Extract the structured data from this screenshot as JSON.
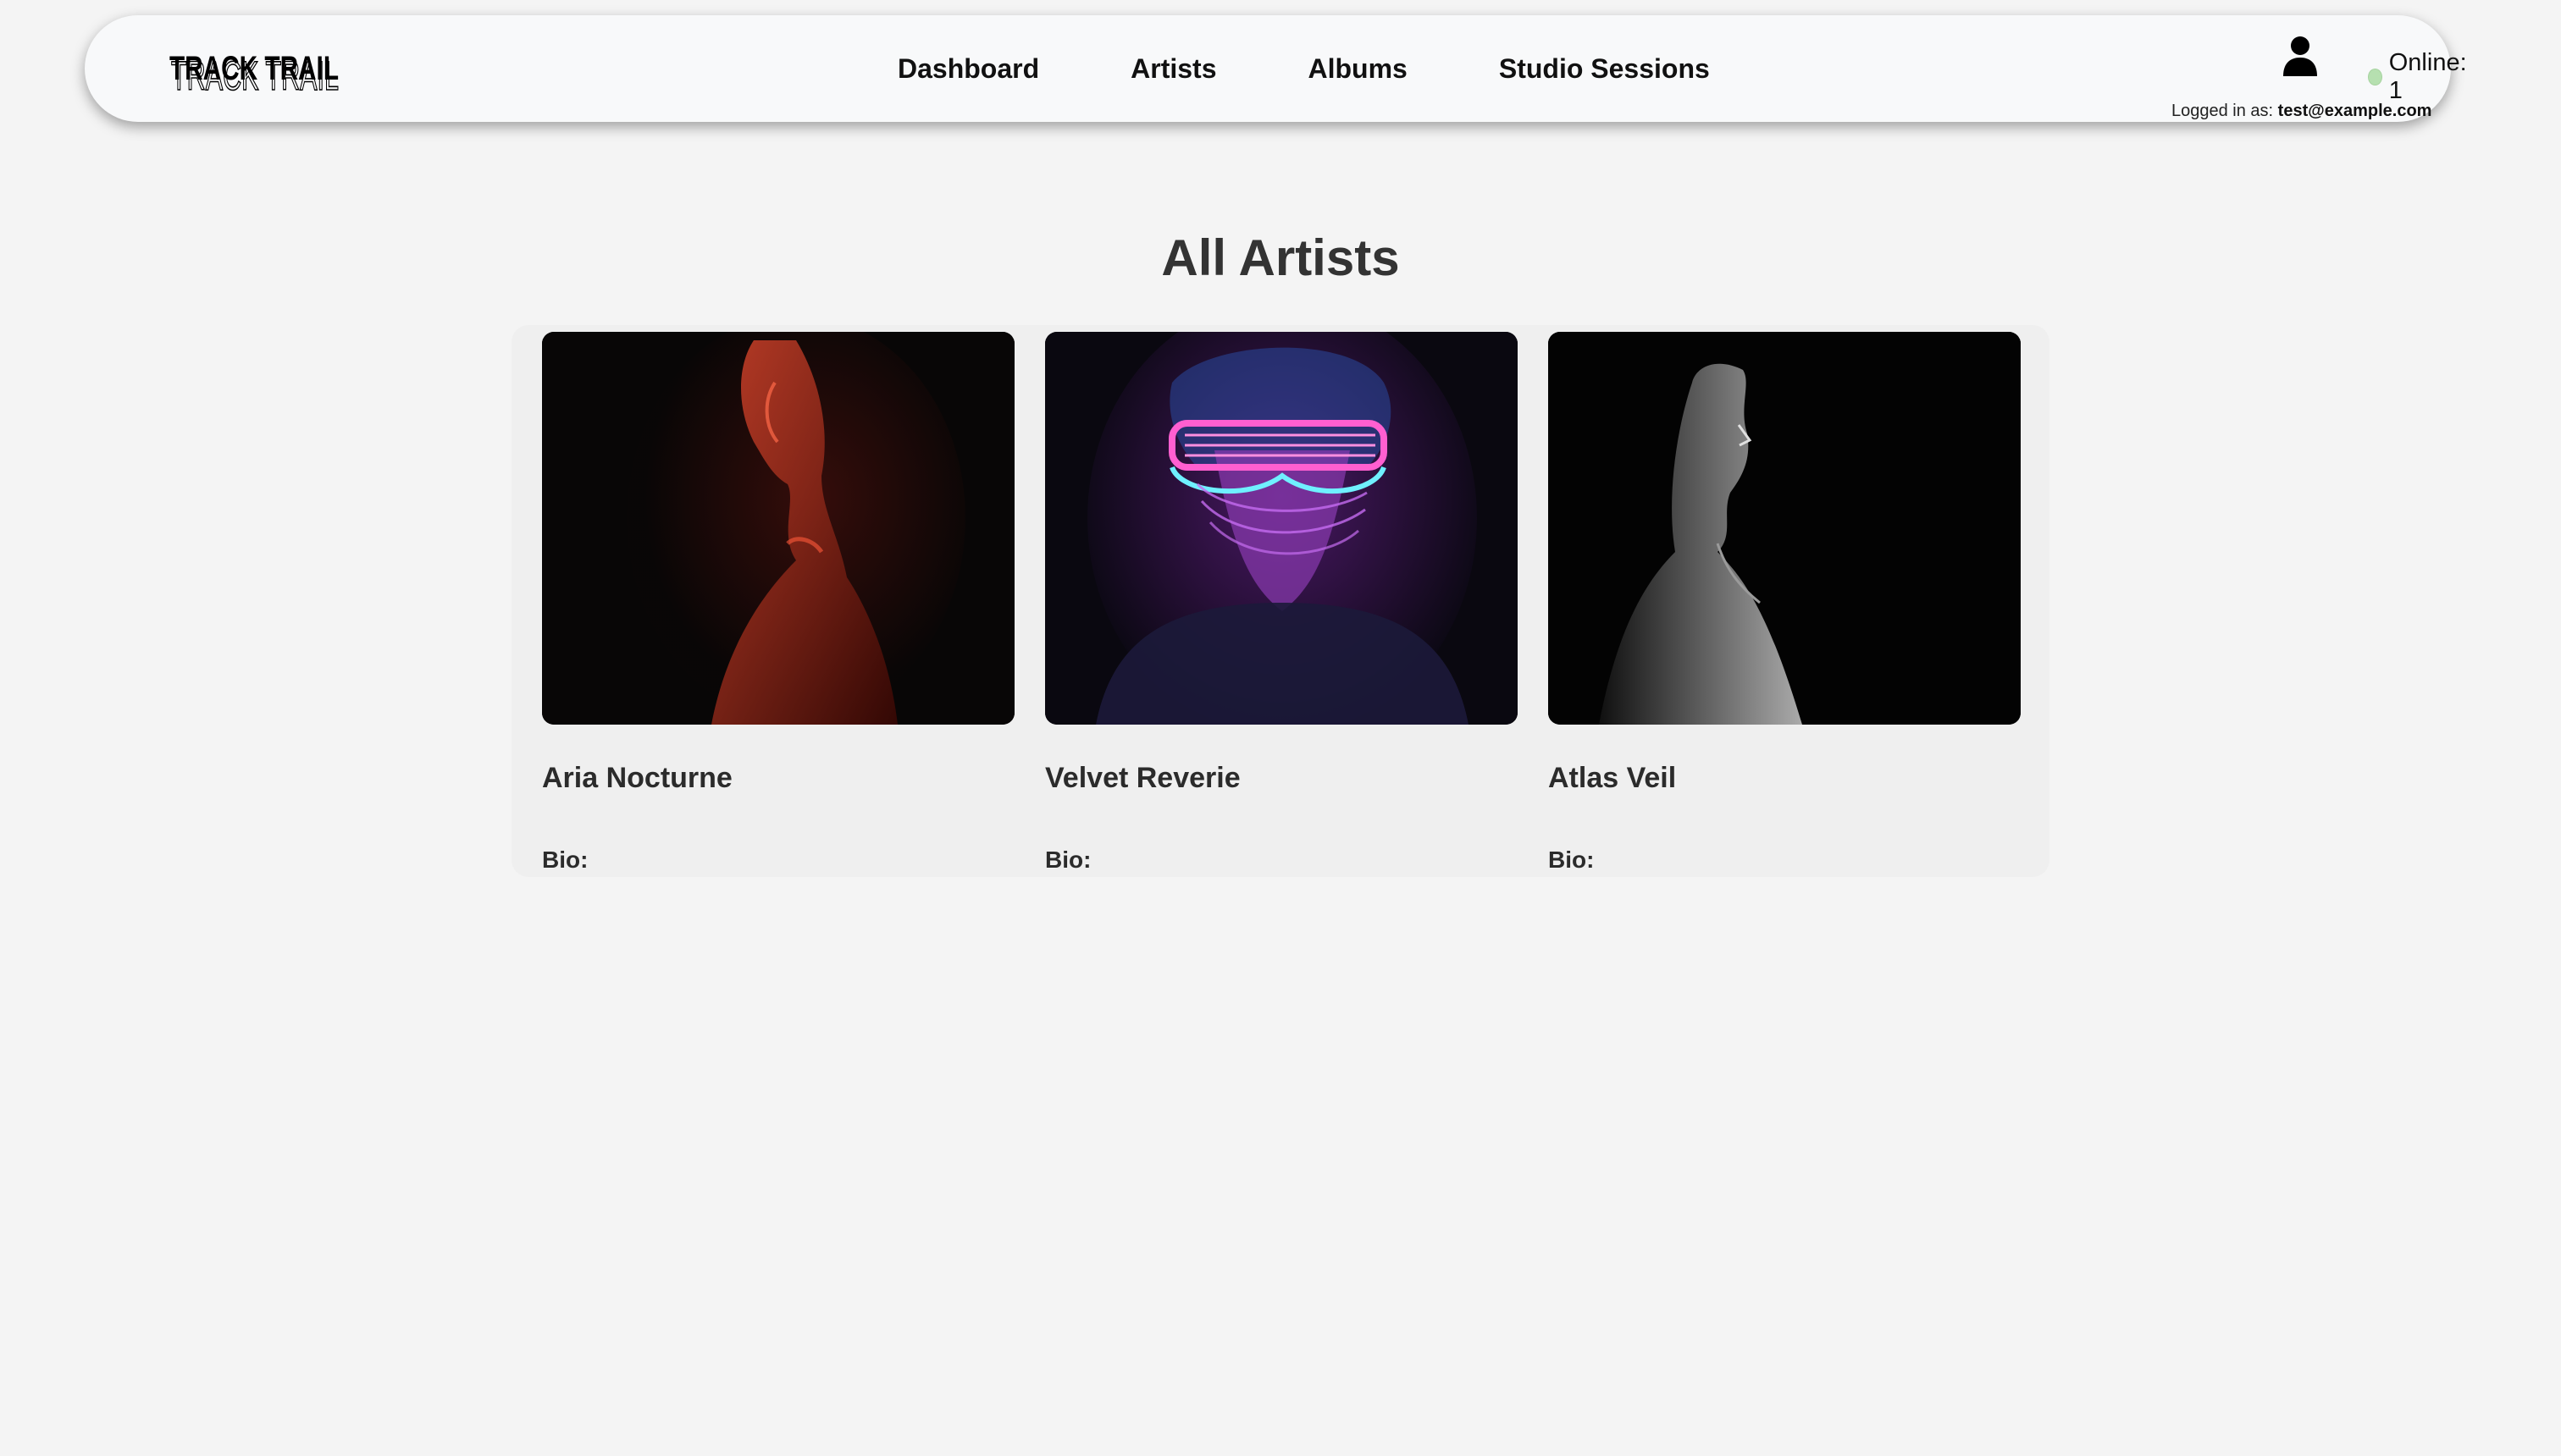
{
  "header": {
    "logo_text": "TRACK TRAIL",
    "nav": [
      {
        "label": "Dashboard"
      },
      {
        "label": "Artists"
      },
      {
        "label": "Albums"
      },
      {
        "label": "Studio Sessions"
      }
    ],
    "online_status": "Online: 1",
    "online_color": "#b6e0b0",
    "logged_in_label": "Logged in as:",
    "logged_in_email": "test@example.com",
    "user_icon": "user-icon"
  },
  "main": {
    "title": "All Artists",
    "artists": [
      {
        "name": "Aria Nocturne",
        "bio_label": "Bio:",
        "photo": "red-lit-portrait"
      },
      {
        "name": "Velvet Reverie",
        "bio_label": "Bio:",
        "photo": "neon-glasses-portrait"
      },
      {
        "name": "Atlas Veil",
        "bio_label": "Bio:",
        "photo": "monochrome-profile-portrait"
      }
    ]
  },
  "colors": {
    "background": "#f4f4f4",
    "navbar": "#f8f9fa",
    "text": "#333333"
  }
}
